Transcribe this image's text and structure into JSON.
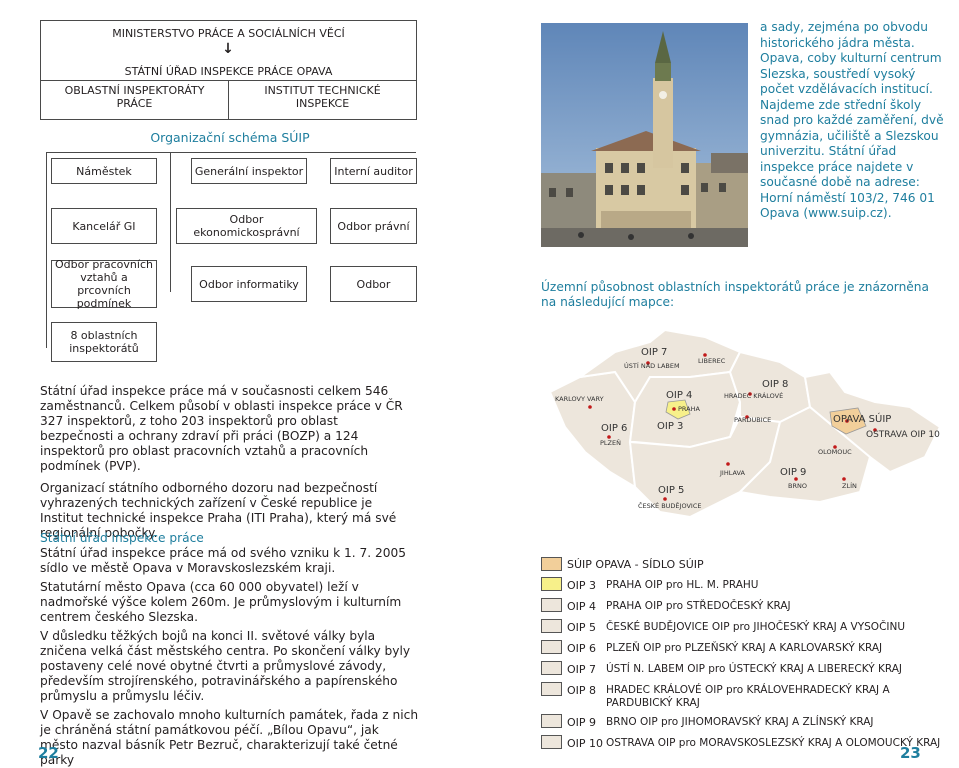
{
  "org_chart": {
    "ministry": "MINISTERSTVO PRÁCE A SOCIÁLNÍCH VĚCÍ",
    "arrow": "↓",
    "suip": "STÁTNÍ ÚŘAD INSPEKCE PRÁCE OPAVA",
    "oip": "OBLASTNÍ INSPEKTORÁTY PRÁCE",
    "institute": "INSTITUT TECHNICKÉ INSPEKCE",
    "title": "Organizační schéma SÚIP",
    "deputy": "Náměstek",
    "inspector_general": "Generální inspektor",
    "internal_auditor": "Interní auditor",
    "office_gi": "Kancelář GI",
    "dept_econ": "Odbor ekonomickosprávní",
    "dept_legal": "Odbor právní",
    "dept_labour": "Odbor pracovních vztahů a prcovních podmínek",
    "dept_it": "Odbor informatiky",
    "dept": "Odbor",
    "regional": "8 oblastních inspektorátů"
  },
  "left_text": {
    "para1": "Státní úřad inspekce práce má v současnosti celkem 546 zaměstnanců. Celkem působí v oblasti inspekce práce v ČR 327 inspektorů, z toho 203 inspektorů pro oblast bezpečnosti a ochrany zdraví při práci (BOZP) a 124 inspektorů pro oblast pracovních vztahů a pracovních podmínek (PVP).",
    "para2": "Organizací státního odborného dozoru nad bezpečností vyhrazených technických zařízení v České republice je Institut technické inspekce Praha (ITI Praha), který má své regionální pobočky.",
    "heading": "Státní úřad inspekce práce",
    "para3": "Státní úřad inspekce práce má od svého vzniku k 1. 7. 2005 sídlo ve městě Opava v Moravskoslezském kraji.",
    "para4": "Statutární město Opava (cca 60 000 obyvatel) leží v nadmořské výšce kolem 260m. Je průmyslovým i kulturním centrem českého Slezska.",
    "para5": "V důsledku těžkých bojů na konci II. světové války byla zničena velká část městského centra. Po skončení války byly postaveny celé nové obytné čtvrti a průmyslové závody, především strojírenského, potravinářského a papírenského průmyslu a průmyslu léčiv.",
    "para6": "V Opavě se zachovalo mnoho kulturních památek, řada z nich je chráněná státní památkovou péčí. „Bílou Opavu“, jak město nazval básník Petr Bezruč, charakterizují také četné parky"
  },
  "right_text": {
    "para1": "a sady, zejména po obvodu historického jádra města. Opava, coby kulturní centrum Slezska, soustředí vysoký počet vzdělávacích institucí. Najdeme zde střední školy snad pro každé zaměření, dvě gymnázia, učiliště a Slezskou univerzitu. Státní úřad inspekce práce najdete v současné době na adrese: Horní náměstí 103/2, 746 01 Opava (www.suip.cz).",
    "map_caption": "Územní působnost oblastních inspektorátů práce je znázorněna na následující mapce:"
  },
  "map": {
    "oip": [
      "OIP 7",
      "OIP 4",
      "OIP 8",
      "OIP 6",
      "OIP 3",
      "OIP 5",
      "OIP 9",
      "OPAVA SÚIP",
      "OSTRAVA OIP 10"
    ],
    "cities": [
      "ÚSTÍ NAD LABEM",
      "LIBEREC",
      "KARLOVY VARY",
      "PRAHA",
      "HRADEC KRÁLOVÉ",
      "PARDUBICE",
      "PLZEŇ",
      "JIHLAVA",
      "ČESKÉ BUDĚJOVICE",
      "BRNO",
      "OLOMOUC",
      "ZLÍN"
    ]
  },
  "legend": {
    "header": "SÚIP OPAVA - SÍDLO SÚIP",
    "items": [
      {
        "code": "OIP 3",
        "text": "PRAHA OIP pro HL. M. PRAHU",
        "color": "#f7f08a"
      },
      {
        "code": "OIP 4",
        "text": "PRAHA OIP pro STŘEDOČESKÝ KRAJ",
        "color": ""
      },
      {
        "code": "OIP 5",
        "text": "ČESKÉ BUDĚJOVICE OIP pro JIHOČESKÝ KRAJ A VYSOČINU",
        "color": ""
      },
      {
        "code": "OIP 6",
        "text": "PLZEŇ OIP pro PLZEŇSKÝ KRAJ A KARLOVARSKÝ KRAJ",
        "color": ""
      },
      {
        "code": "OIP 7",
        "text": "ÚSTÍ N. LABEM OIP pro ÚSTECKÝ KRAJ A LIBERECKÝ KRAJ",
        "color": ""
      },
      {
        "code": "OIP 8",
        "text": "HRADEC KRÁLOVÉ OIP pro KRÁLOVEHRADECKÝ KRAJ A PARDUBICKÝ KRAJ",
        "color": ""
      },
      {
        "code": "OIP 9",
        "text": "BRNO OIP pro JIHOMORAVSKÝ KRAJ A ZLÍNSKÝ KRAJ",
        "color": ""
      },
      {
        "code": "OIP 10",
        "text": "OSTRAVA OIP pro MORAVSKOSLEZSKÝ KRAJ A OLOMOUCKÝ KRAJ",
        "color": ""
      }
    ],
    "header_color": "#f2cf9a"
  },
  "page": {
    "left": "22",
    "right": "23"
  },
  "colors": {
    "accent": "#1e7e9e",
    "map_fill": "#ede6dc",
    "map_stroke": "#ffffff",
    "praha": "#f7f08a",
    "opava": "#f2cf9a"
  }
}
